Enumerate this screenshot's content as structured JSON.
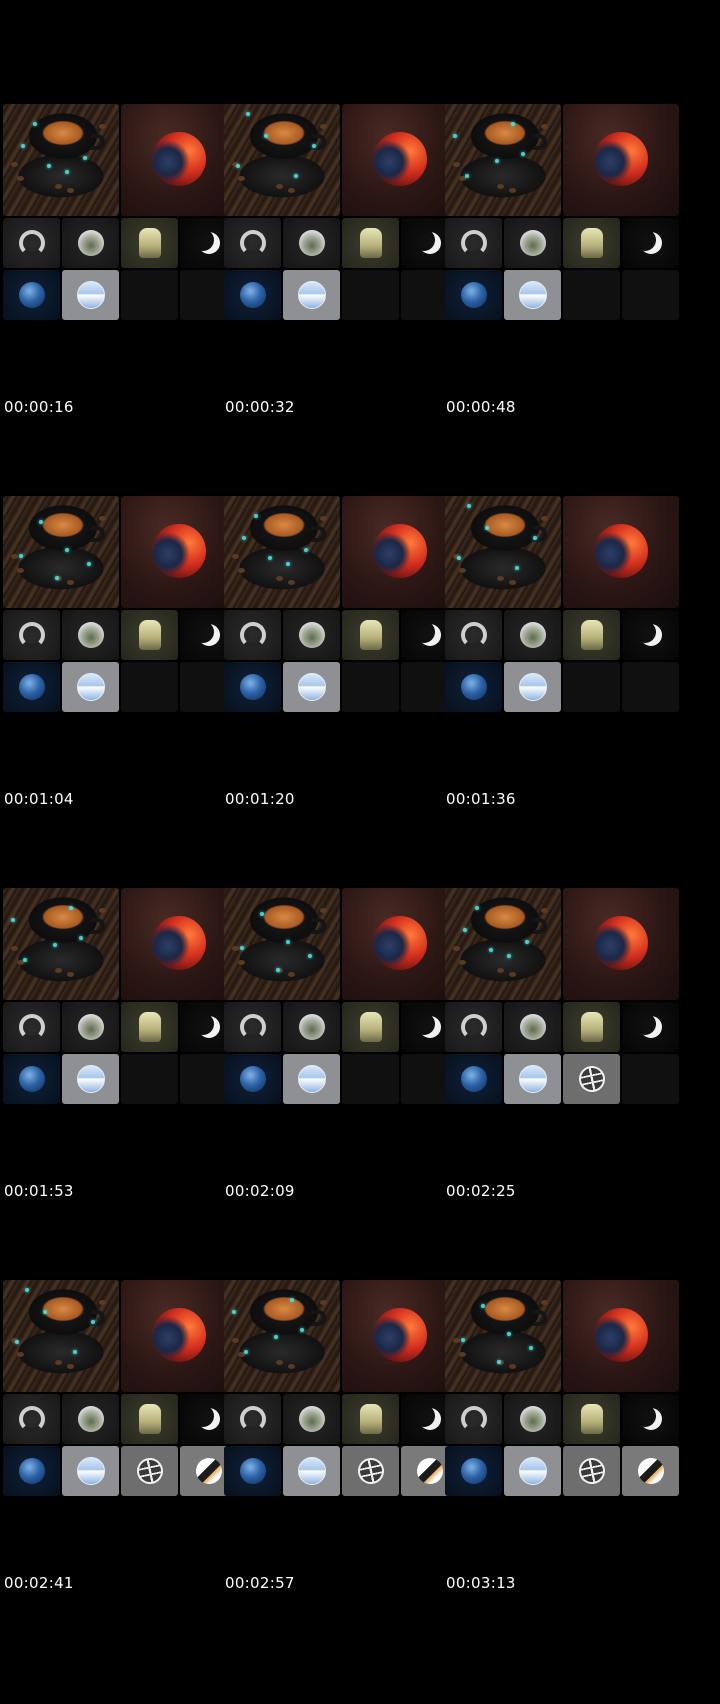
{
  "sheet": {
    "frames": [
      {
        "time": "00:00:16",
        "extra_tiles": 0
      },
      {
        "time": "00:00:32",
        "extra_tiles": 0
      },
      {
        "time": "00:00:48",
        "extra_tiles": 0
      },
      {
        "time": "00:01:04",
        "extra_tiles": 0
      },
      {
        "time": "00:01:20",
        "extra_tiles": 0
      },
      {
        "time": "00:01:36",
        "extra_tiles": 0
      },
      {
        "time": "00:01:53",
        "extra_tiles": 0
      },
      {
        "time": "00:02:09",
        "extra_tiles": 0
      },
      {
        "time": "00:02:25",
        "extra_tiles": 1
      },
      {
        "time": "00:02:41",
        "extra_tiles": 2
      },
      {
        "time": "00:02:57",
        "extra_tiles": 2
      },
      {
        "time": "00:03:13",
        "extra_tiles": 2
      }
    ],
    "tile_icons": {
      "large": [
        "coffee-cup-icon",
        "planet-orb-icon"
      ],
      "row1": [
        "ring-icon",
        "tree-circle-icon",
        "figure-icon",
        "crescent-icon"
      ],
      "row2": [
        "earth-icon",
        "sky-circle-icon",
        "globe-grid-icon",
        "penguin-icon"
      ]
    },
    "colors": {
      "background": "#000000",
      "timestamp": "#ffffff",
      "sparkle": "#4fe3e0"
    }
  }
}
